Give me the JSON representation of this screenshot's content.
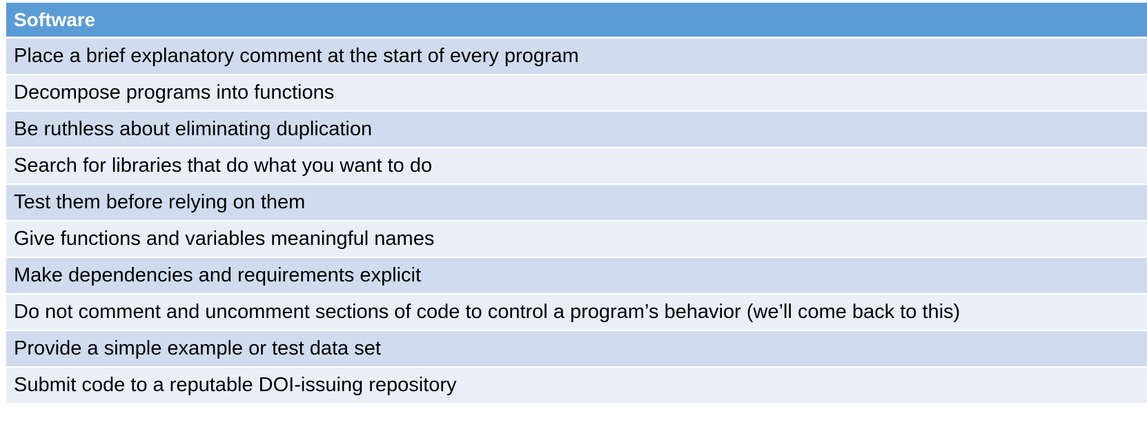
{
  "table": {
    "header": "Software",
    "rows": [
      "Place a brief explanatory comment at the start of every program",
      "Decompose programs into functions",
      "Be ruthless about eliminating duplication",
      "Search for libraries that do what you want to do",
      "Test them before relying on them",
      "Give functions and variables meaningful names",
      "Make dependencies and requirements explicit",
      "Do not comment and uncomment sections of code to control a program’s behavior (we’ll come back to this)",
      "Provide a simple example or test data set",
      "Submit code to a reputable DOI-issuing repository"
    ]
  },
  "colors": {
    "header_bg": "#5b9bd5",
    "row_dark": "#d0dcee",
    "row_light": "#e9eef7"
  }
}
